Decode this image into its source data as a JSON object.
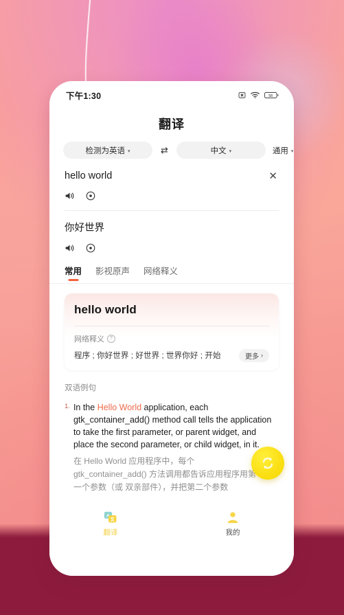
{
  "theme": {
    "accent_orange": "#f4613d",
    "accent_yellow": "#fbe016",
    "backdrop_bottom": "#8d1b3d",
    "card_tint": "#fbe7e4"
  },
  "status_bar": {
    "time": "下午1:30",
    "icons": [
      "alarm-icon",
      "wifi-icon",
      "battery-icon"
    ],
    "battery_level": "58"
  },
  "header": {
    "title": "翻译"
  },
  "language_bar": {
    "source_label": "检测为英语",
    "swap_glyph": "⇄",
    "target_label": "中文",
    "mode_label": "通用",
    "caret": "▾"
  },
  "source": {
    "text": "hello world",
    "clear_glyph": "✕",
    "actions": [
      "speaker-icon",
      "copy-icon"
    ]
  },
  "target": {
    "text": "你好世界",
    "actions": [
      "speaker-icon",
      "copy-icon"
    ]
  },
  "tabs": [
    {
      "label": "常用",
      "active": true
    },
    {
      "label": "影视原声",
      "active": false
    },
    {
      "label": "网络释义",
      "active": false
    }
  ],
  "result_card": {
    "word": "hello world",
    "section_label": "网络释义",
    "help_glyph": "?",
    "definitions": "程序 ; 你好世界 ; 好世界 ; 世界你好 ; 开始",
    "more_label": "更多",
    "more_chevron": "›"
  },
  "examples": {
    "heading": "双语例句",
    "items": [
      {
        "number": "1.",
        "en_before": "In the ",
        "en_highlight": "Hello World",
        "en_after": " application, each gtk_container_add() method call tells the application to take the first parameter, or parent widget, and place the second parameter, or child widget, in it.",
        "cn": "在 Hello World 应用程序中，每个 gtk_container_add() 方法调用都告诉应用程序用第一个参数（或 双亲部件），并把第二个参数",
        "speaker_icon": "speaker-icon"
      }
    ]
  },
  "fab": {
    "icon": "refresh-swap-icon"
  },
  "bottom_nav": [
    {
      "label": "翻译",
      "icon": "translate-icon",
      "active": true
    },
    {
      "label": "我的",
      "icon": "person-icon",
      "active": false
    }
  ]
}
